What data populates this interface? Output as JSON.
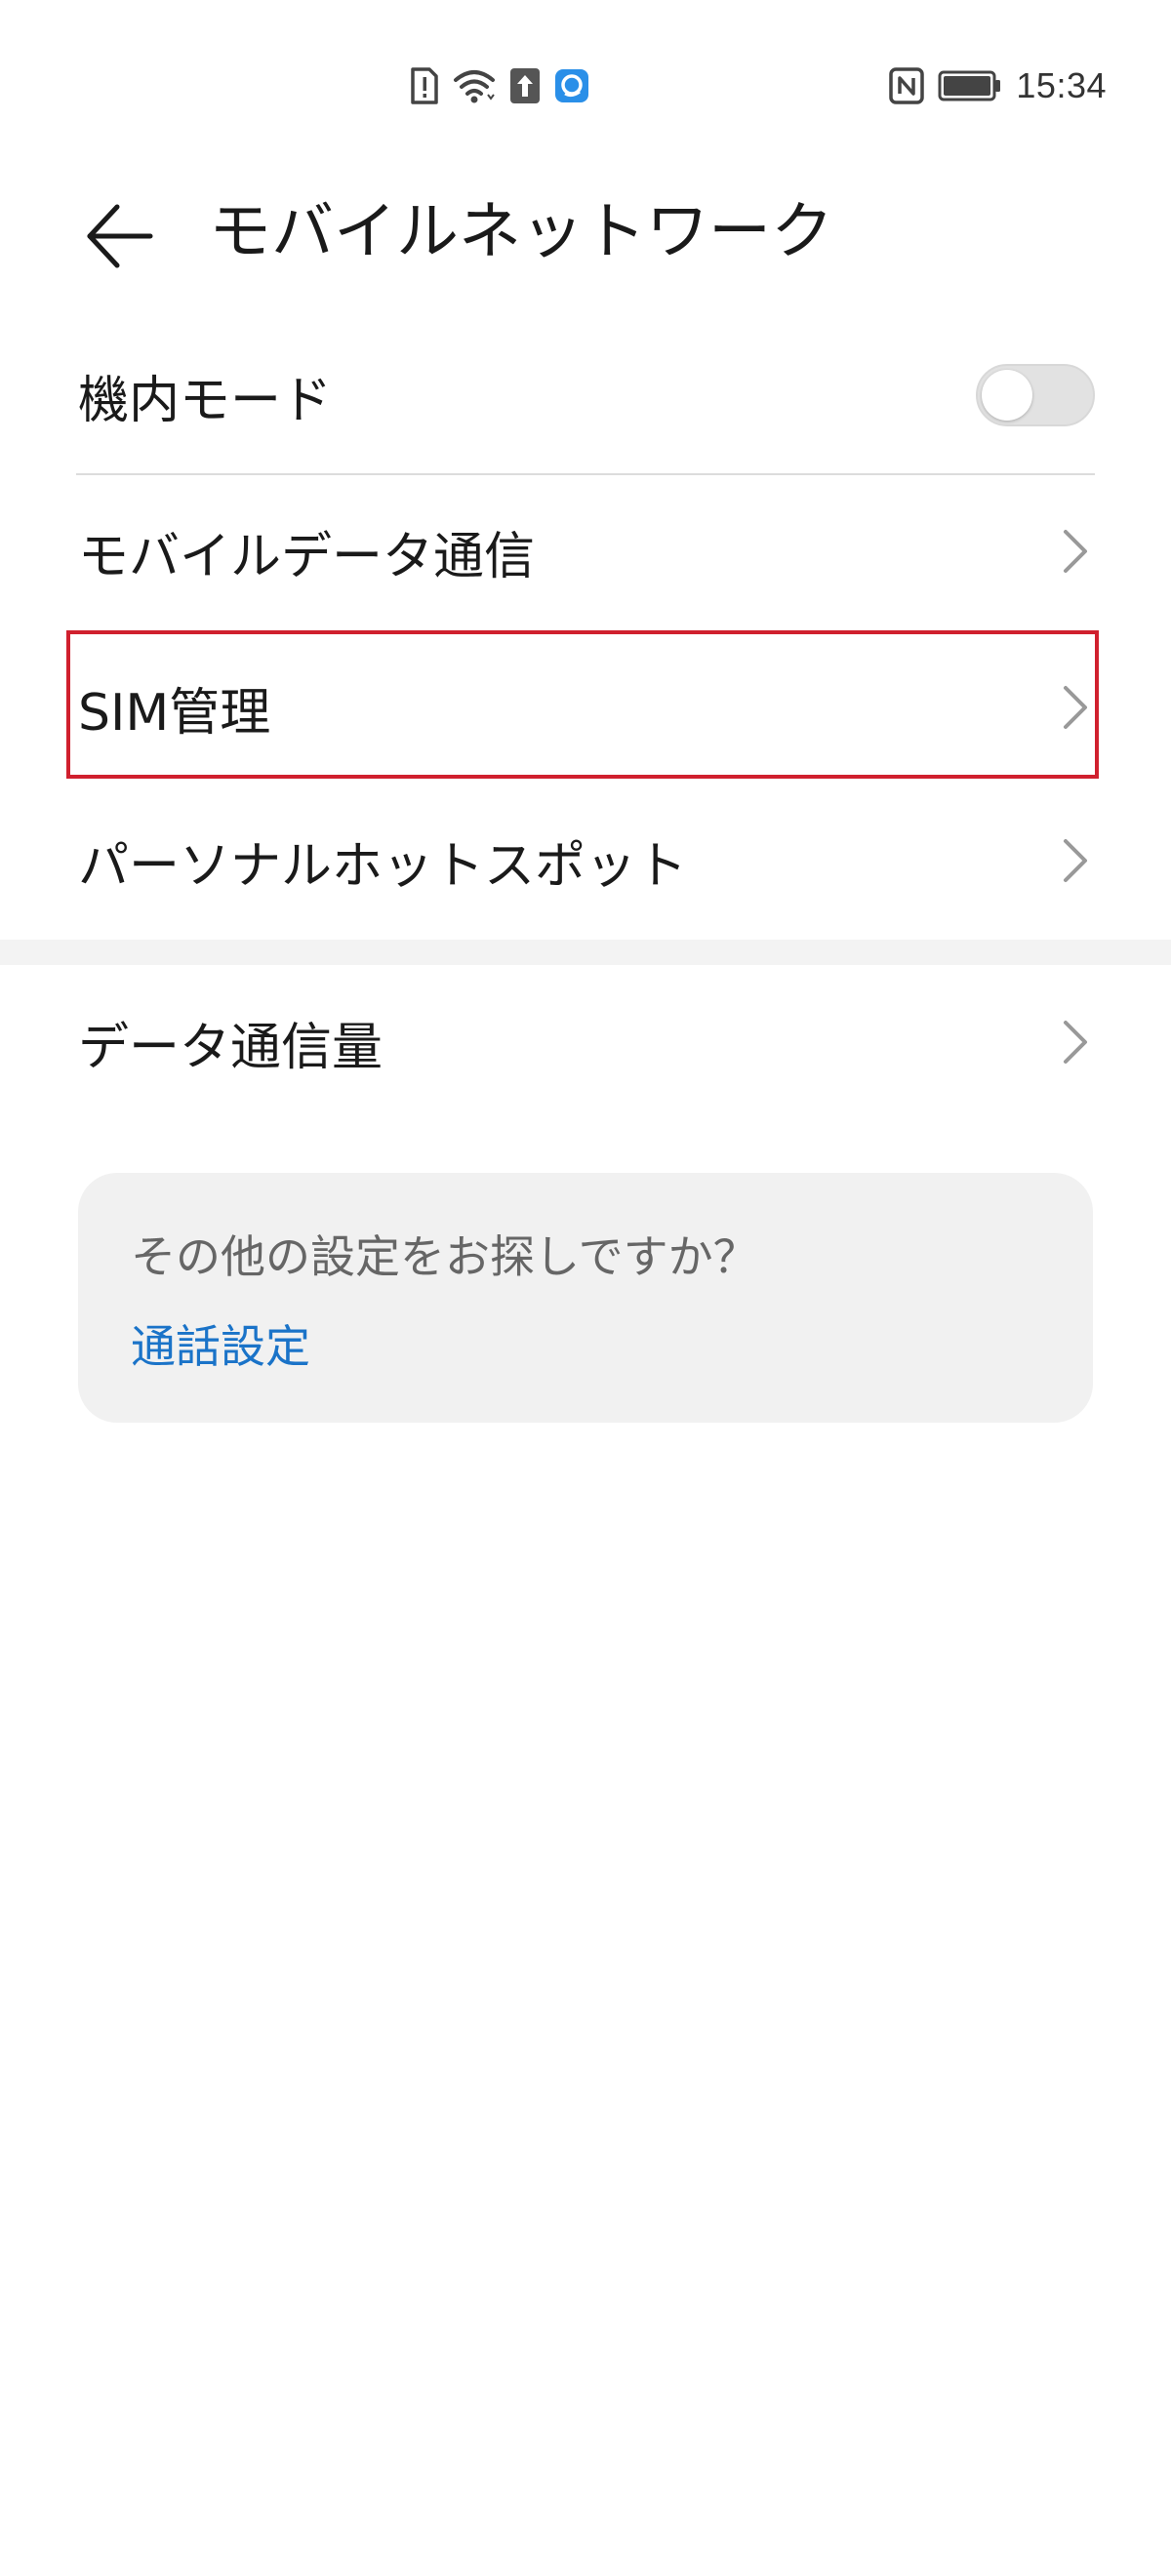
{
  "status_bar": {
    "time": "15:34",
    "icons": [
      "sim-alert-icon",
      "wifi-icon",
      "upload-icon",
      "app-notification-icon",
      "nfc-icon",
      "battery-icon"
    ]
  },
  "header": {
    "title": "モバイルネットワーク",
    "back_icon": "back-arrow-icon"
  },
  "settings": {
    "airplane_mode": {
      "label": "機内モード",
      "enabled": false
    },
    "items": [
      {
        "label": "モバイルデータ通信"
      },
      {
        "label": "SIM管理",
        "highlighted": true
      },
      {
        "label": "パーソナルホットスポット"
      },
      {
        "label": "データ通信量"
      }
    ]
  },
  "suggestion": {
    "question": "その他の設定をお探しですか？",
    "link": "通話設定"
  },
  "colors": {
    "highlight_border": "#d0202e",
    "link": "#1a73c8",
    "card_background": "#f1f1f1"
  }
}
